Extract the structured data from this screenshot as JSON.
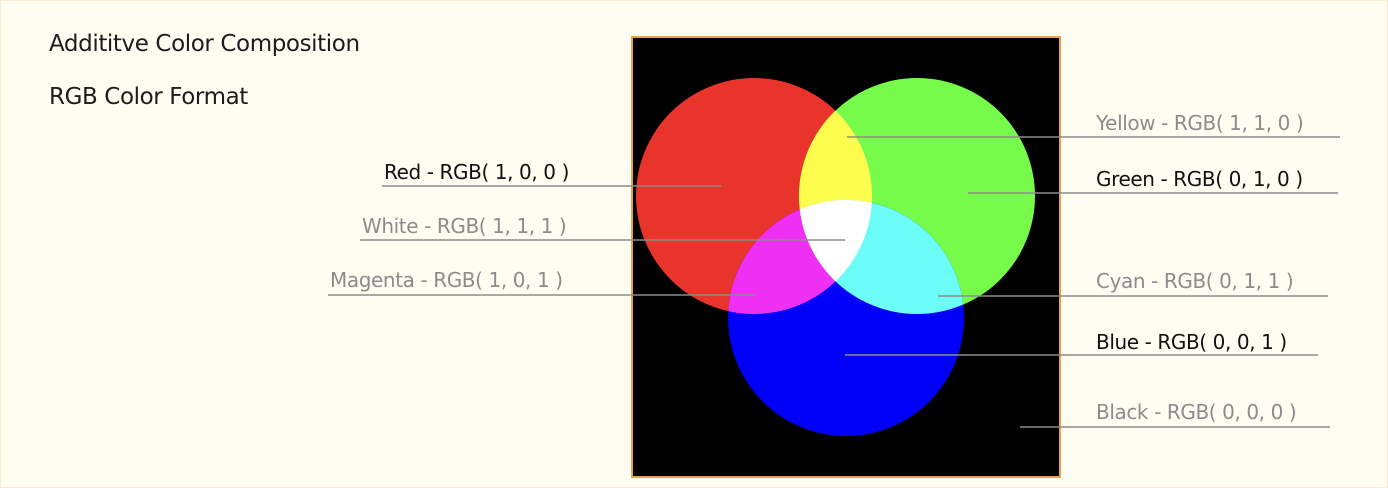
{
  "titles": {
    "line1": "Addititve Color Composition",
    "line2": "RGB Color Format"
  },
  "colors": {
    "page_background": "#fffdf2",
    "panel_background": "#000000",
    "panel_border": "#e8a24a",
    "red": "#e8342a",
    "green": "#76fb4a",
    "blue": "#0000f8",
    "yellow": "#fcfd4d",
    "magenta": "#f02ff4",
    "cyan": "#6cfcf8",
    "white": "#ffffff",
    "label_dark": "#111111",
    "label_muted": "#8c8c8c"
  },
  "labels": {
    "red": "Red - RGB( 1, 0, 0 )",
    "white": "White - RGB( 1, 1, 1 )",
    "magenta": "Magenta - RGB( 1, 0, 1 )",
    "yellow": "Yellow - RGB( 1, 1, 0 )",
    "green": "Green - RGB( 0, 1, 0 )",
    "cyan": "Cyan - RGB( 0, 1, 1 )",
    "blue": "Blue - RGB( 0, 0, 1 )",
    "black": "Black - RGB( 0, 0, 0 )"
  }
}
